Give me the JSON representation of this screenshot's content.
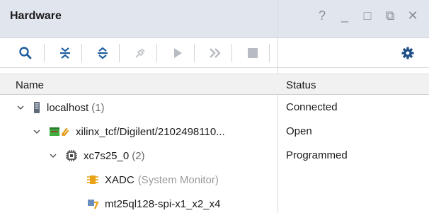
{
  "panel": {
    "title": "Hardware",
    "controls": {
      "help": "?",
      "minimize": "_",
      "maximize": "□",
      "float": "⧉",
      "close": "✕"
    }
  },
  "table": {
    "columns": {
      "name": "Name",
      "status": "Status"
    },
    "rows": [
      {
        "label": "localhost",
        "count": "(1)",
        "status": "Connected"
      },
      {
        "label": "xilinx_tcf/Digilent/2102498110...",
        "status": "Open"
      },
      {
        "label": "xc7s25_0",
        "count": "(2)",
        "status": "Programmed"
      },
      {
        "label": "XADC",
        "extra": "(System Monitor)",
        "status": ""
      },
      {
        "label": "mt25ql128-spi-x1_x2_x4",
        "status": ""
      }
    ]
  },
  "colors": {
    "titlebar": "#e1e6ee",
    "accent_blue": "#1f5f9e",
    "chip_green": "#3fae3f",
    "xadc_orange": "#e8a317"
  }
}
